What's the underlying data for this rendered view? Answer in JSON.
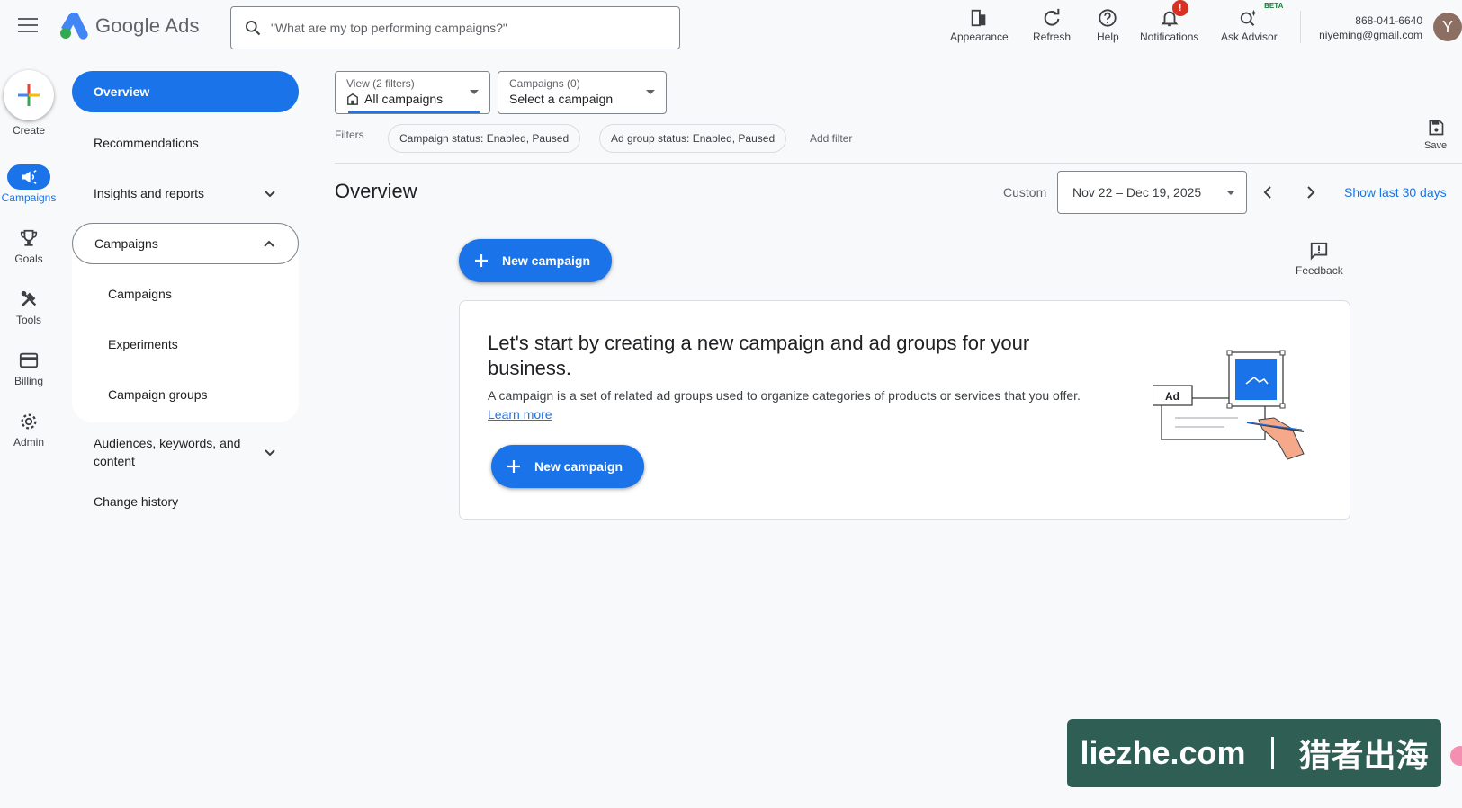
{
  "app": {
    "name": "Google Ads",
    "search_placeholder": "\"What are my top performing campaigns?\""
  },
  "toolbar": {
    "appearance": "Appearance",
    "refresh": "Refresh",
    "help": "Help",
    "notifications": "Notifications",
    "notifications_badge": "!",
    "ask_advisor": "Ask Advisor",
    "beta": "BETA"
  },
  "account": {
    "phone": "868-041-6640",
    "email": "niyeming@gmail.com",
    "avatar_letter": "Y"
  },
  "rail": {
    "create": "Create",
    "campaigns": "Campaigns",
    "goals": "Goals",
    "tools": "Tools",
    "billing": "Billing",
    "admin": "Admin"
  },
  "nav": {
    "overview": "Overview",
    "recommendations": "Recommendations",
    "insights": "Insights and reports",
    "campaigns_group": "Campaigns",
    "campaigns": "Campaigns",
    "experiments": "Experiments",
    "campaign_groups": "Campaign groups",
    "audiences_line1": "Audiences, keywords, and",
    "audiences_line2": "content",
    "change_history": "Change history"
  },
  "view_dropdown": {
    "label": "View (2 filters)",
    "value": "All campaigns"
  },
  "campaign_dropdown": {
    "label": "Campaigns (0)",
    "value": "Select a campaign"
  },
  "filters": {
    "label": "Filters",
    "chips": [
      "Campaign status: Enabled, Paused",
      "Ad group status: Enabled, Paused"
    ],
    "add_filter": "Add filter",
    "save": "Save"
  },
  "page": {
    "title": "Overview",
    "date_mode": "Custom",
    "date_range": "Nov 22 – Dec 19, 2025",
    "show_last": "Show last 30 days",
    "new_campaign": "New campaign",
    "feedback": "Feedback"
  },
  "card": {
    "title": "Let's start by creating a new campaign and ad groups for your business.",
    "description": "A campaign is a set of related ad groups used to organize categories of products or services that you offer.",
    "learn_more": "Learn more",
    "button": "New campaign",
    "illustration_label": "Ad"
  },
  "watermark": {
    "left": "liezhe.com",
    "right": "猎者出海"
  },
  "colors": {
    "primary": "#1a73e8",
    "badge": "#d93025",
    "watermark_bg": "#2f5e55"
  }
}
